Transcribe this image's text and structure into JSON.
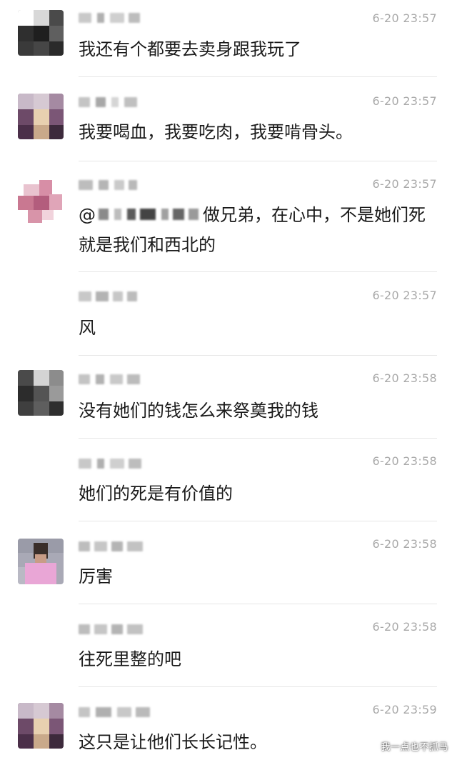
{
  "messages": [
    {
      "time": "6-20 23:57",
      "text": "我还有个都要去卖身跟我玩了",
      "avatar": "pixelated-dark"
    },
    {
      "time": "6-20 23:57",
      "text": "我要喝血，我要吃肉，我要啃骨头。",
      "avatar": "pixelated-purple"
    },
    {
      "time": "6-20 23:57",
      "mention_prefix": "@",
      "text": "做兄弟，在心中，不是她们死就是我们和西北的",
      "avatar": "pixelated-pink"
    },
    {
      "time": "6-20 23:57",
      "text": "风"
    },
    {
      "time": "6-20 23:58",
      "text": "没有她们的钱怎么来祭奠我的钱",
      "avatar": "pixelated-dark"
    },
    {
      "time": "6-20 23:58",
      "text": "她们的死是有价值的"
    },
    {
      "time": "6-20 23:58",
      "text": "厉害",
      "avatar": "pixelated-person-pink"
    },
    {
      "time": "6-20 23:58",
      "text": "往死里整的吧"
    },
    {
      "time": "6-20 23:59",
      "text": "这只是让他们长长记性。",
      "avatar": "pixelated-purple"
    }
  ],
  "watermark": "我一点也不抓马"
}
